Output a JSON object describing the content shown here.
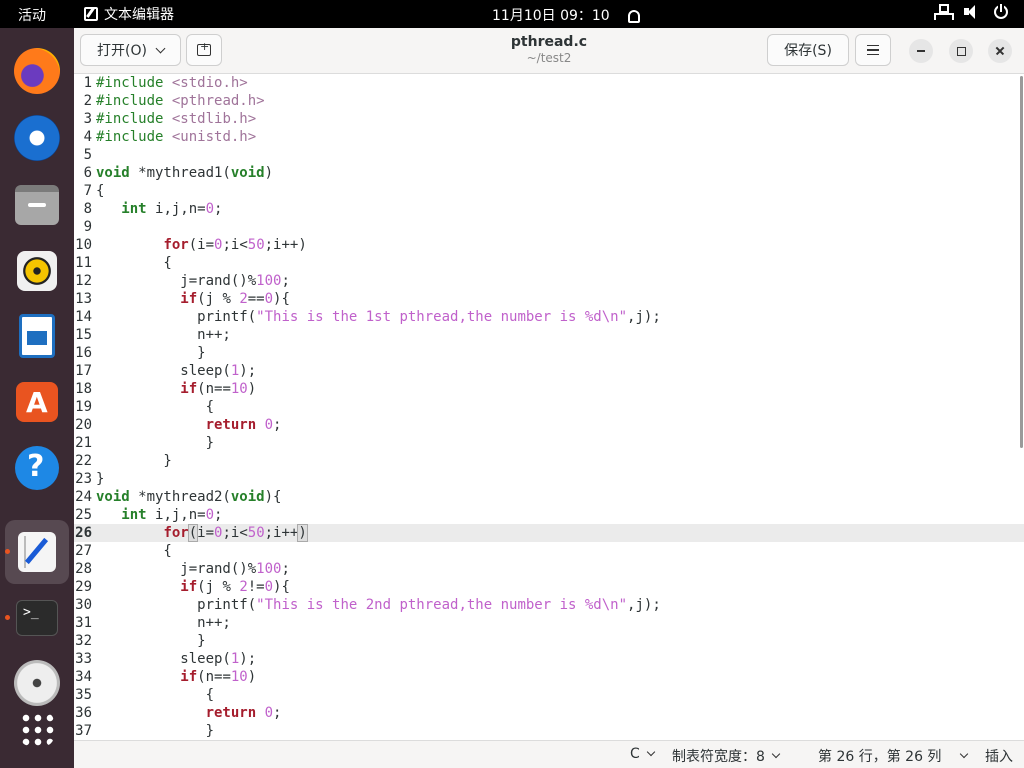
{
  "topbar": {
    "activities": "活动",
    "app_name": "文本编辑器",
    "clock": "11月10日  09：10"
  },
  "dock": {
    "items": [
      "firefox-icon",
      "thunderbird-icon",
      "files-icon",
      "rhythmbox-icon",
      "libreoffice-writer-icon",
      "app-store-icon",
      "help-icon",
      "text-editor-icon",
      "terminal-icon",
      "disc-icon",
      "show-apps-icon"
    ]
  },
  "header": {
    "open_label": "打开(O)",
    "title": "pthread.c",
    "subtitle": "~/test2",
    "save_label": "保存(S)"
  },
  "editor": {
    "current_line": 26,
    "lines": [
      "#include <stdio.h>",
      "#include <pthread.h>",
      "#include <stdlib.h>",
      "#include <unistd.h>",
      "",
      "void *mythread1(void)",
      "{",
      "   int i,j,n=0;",
      "",
      "        for(i=0;i<50;i++)",
      "        {",
      "          j=rand()%100;",
      "          if(j % 2==0){",
      "            printf(\"This is the 1st pthread,the number is %d\\n\",j);",
      "            n++;",
      "            }",
      "          sleep(1);",
      "          if(n==10)",
      "             {",
      "             return 0;",
      "             }",
      "        }",
      "}",
      "void *mythread2(void){",
      "   int i,j,n=0;",
      "        for(i=0;i<50;i++)",
      "        {",
      "          j=rand()%100;",
      "          if(j % 2!=0){",
      "            printf(\"This is the 2nd pthread,the number is %d\\n\",j);",
      "            n++;",
      "            }",
      "          sleep(1);",
      "          if(n==10)",
      "             {",
      "             return 0;",
      "             }"
    ]
  },
  "statusbar": {
    "language": "C",
    "tab_width": "制表符宽度：8",
    "position": "第 26 行，第 26 列",
    "mode": "插入"
  }
}
